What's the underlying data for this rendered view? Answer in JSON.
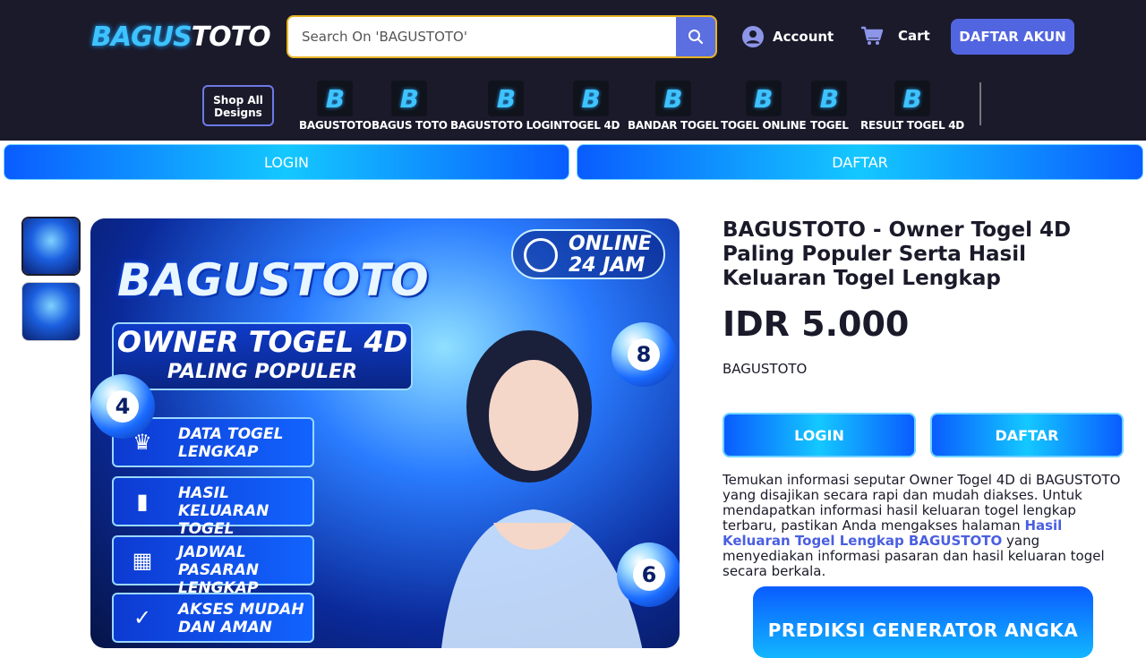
{
  "header": {
    "logo_part1": "BAGUS",
    "logo_part2": "TOTO",
    "search_placeholder": "Search On 'BAGUSTOTO'",
    "account_label": "Account",
    "cart_label": "Cart",
    "register_button": "DAFTAR AKUN"
  },
  "nav": {
    "shop_all": "Shop All Designs",
    "icon_letter": "B",
    "categories": [
      {
        "label": "BAGUSTOTO"
      },
      {
        "label": "BAGUS TOTO"
      },
      {
        "label": "BAGUSTOTO LOGIN"
      },
      {
        "label": "TOGEL 4D"
      },
      {
        "label": "BANDAR TOGEL"
      },
      {
        "label": "TOGEL ONLINE"
      },
      {
        "label": "TOGEL"
      },
      {
        "label": "RESULT TOGEL 4D"
      }
    ]
  },
  "topbar": {
    "login": "LOGIN",
    "daftar": "DAFTAR"
  },
  "hero": {
    "brand": "BAGUSTOTO",
    "headline": "OWNER TOGEL 4D",
    "subline": "PALING POPULER",
    "online_1": "ONLINE",
    "online_2": "24 JAM",
    "features": [
      {
        "l1": "DATA TOGEL",
        "l2": "LENGKAP"
      },
      {
        "l1": "HASIL KELUARAN",
        "l2": "TOGEL TERBARU"
      },
      {
        "l1": "JADWAL PASARAN",
        "l2": "LENGKAP"
      },
      {
        "l1": "AKSES MUDAH",
        "l2": "DAN AMAN"
      }
    ],
    "balls": [
      "4",
      "8",
      "6"
    ]
  },
  "product": {
    "title": "BAGUSTOTO - Owner Togel 4D Paling Populer Serta Hasil Keluaran Togel Lengkap",
    "price": "IDR 5.000",
    "brand": "BAGUSTOTO",
    "login_button": "LOGIN",
    "daftar_button": "DAFTAR",
    "desc_before": "Temukan informasi seputar Owner Togel 4D di BAGUSTOTO yang disajikan secara rapi dan mudah diakses. Untuk mendapatkan informasi hasil keluaran togel lengkap terbaru, pastikan Anda mengakses halaman ",
    "desc_link": "Hasil Keluaran Togel Lengkap BAGUSTOTO",
    "desc_after": " yang menyediakan informasi pasaran dan hasil keluaran togel secara berkala.",
    "promo": "PREDIKSI GENERATOR ANGKA"
  },
  "colors": {
    "header_bg": "#1b1a2b",
    "accent": "#5265e0",
    "search_border": "#e6b325",
    "brand_cyan": "#3ec3ff"
  }
}
